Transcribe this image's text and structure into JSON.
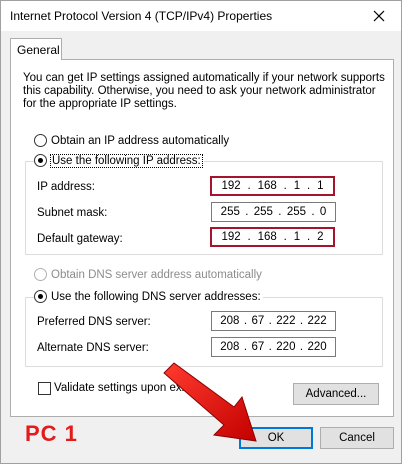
{
  "window": {
    "title": "Internet Protocol Version 4 (TCP/IPv4) Properties",
    "close_icon": "close-icon"
  },
  "tabs": [
    {
      "label": "General",
      "selected": true
    }
  ],
  "intro_text": "You can get IP settings assigned automatically if your network supports this capability. Otherwise, you need to ask your network administrator for the appropriate IP settings.",
  "ip_section": {
    "auto_label": "Obtain an IP address automatically",
    "auto_checked": false,
    "manual_label": "Use the following IP address:",
    "manual_checked": true,
    "fields": [
      {
        "label": "IP address:",
        "octets": [
          "192",
          "168",
          "1",
          "1"
        ],
        "highlighted": true
      },
      {
        "label": "Subnet mask:",
        "octets": [
          "255",
          "255",
          "255",
          "0"
        ],
        "highlighted": false
      },
      {
        "label": "Default gateway:",
        "octets": [
          "192",
          "168",
          "1",
          "2"
        ],
        "highlighted": true
      }
    ]
  },
  "dns_section": {
    "auto_label": "Obtain DNS server address automatically",
    "auto_checked": false,
    "auto_disabled": true,
    "manual_label": "Use the following DNS server addresses:",
    "manual_checked": true,
    "fields": [
      {
        "label": "Preferred DNS server:",
        "octets": [
          "208",
          "67",
          "222",
          "222"
        ]
      },
      {
        "label": "Alternate DNS server:",
        "octets": [
          "208",
          "67",
          "220",
          "220"
        ]
      }
    ]
  },
  "validate": {
    "label": "Validate settings upon exit",
    "checked": false
  },
  "buttons": {
    "advanced": "Advanced...",
    "ok": "OK",
    "cancel": "Cancel"
  },
  "annotation": {
    "label": "PC 1",
    "color": "#e31b1b"
  },
  "colors": {
    "highlight_border": "#a5132c",
    "default_button_border": "#0078d7"
  }
}
